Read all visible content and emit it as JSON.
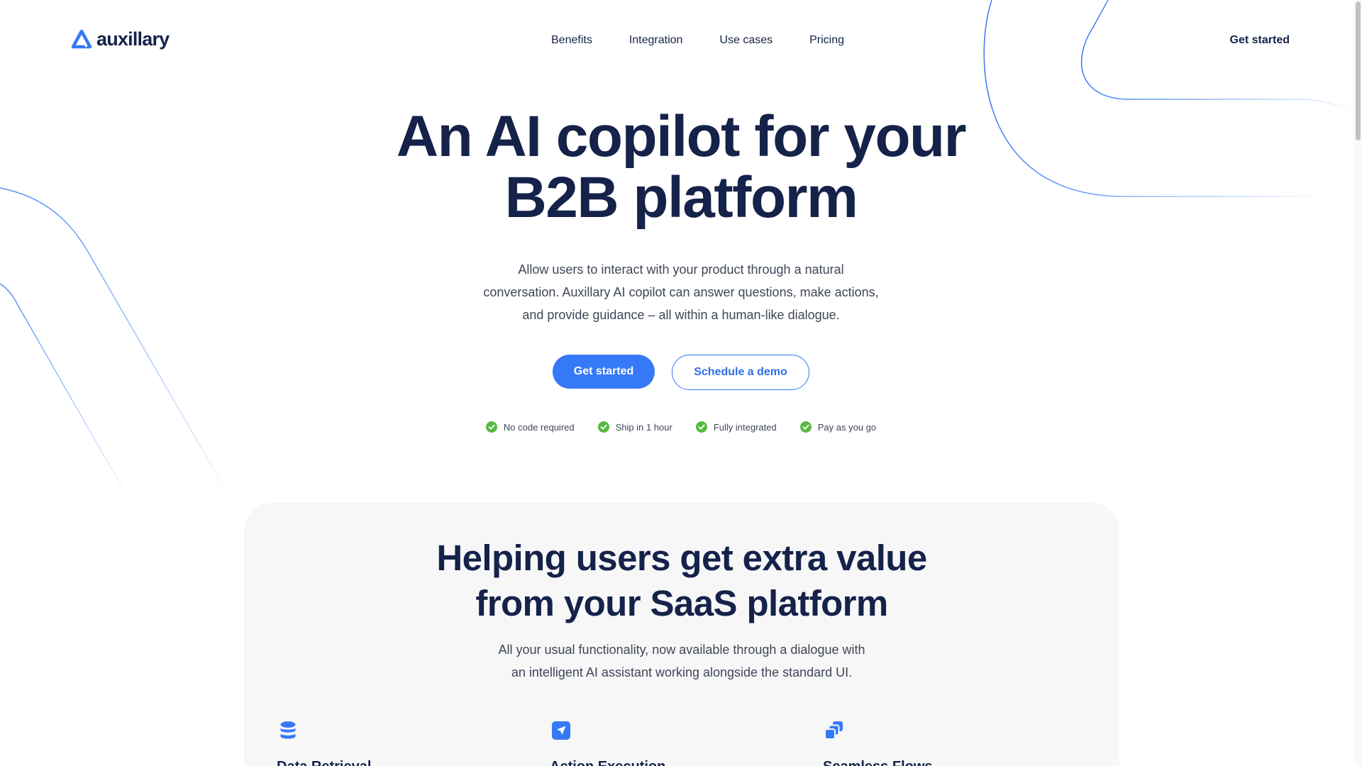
{
  "brand": {
    "name": "auxillary",
    "accent": "#3579f6",
    "ink": "#15224a"
  },
  "nav": {
    "items": [
      "Benefits",
      "Integration",
      "Use cases",
      "Pricing"
    ],
    "cta": "Get started"
  },
  "hero": {
    "title_line1": "An AI copilot for your",
    "title_line2": "B2B platform",
    "description_line1": "Allow users to interact with your product through a natural",
    "description_line2": "conversation. Auxillary AI copilot can answer questions, make actions,",
    "description_line3": "and provide guidance – all within a human-like dialogue.",
    "primary_button": "Get started",
    "secondary_button": "Schedule a demo",
    "features": [
      "No code required",
      "Ship in 1 hour",
      "Fully integrated",
      "Pay as you go"
    ],
    "check_icon": "check-circle-icon",
    "check_color": "#57b93f"
  },
  "value": {
    "title_line1": "Helping users get extra value",
    "title_line2": "from your SaaS platform",
    "description_line1": "All your usual functionality, now available through a dialogue with",
    "description_line2": "an intelligent AI assistant working alongside the standard UI.",
    "cards": [
      {
        "icon": "database-icon",
        "title": "Data Retrieval"
      },
      {
        "icon": "send-icon",
        "title": "Action Execution"
      },
      {
        "icon": "stacked-cards-icon",
        "title": "Seamless Flows"
      }
    ]
  }
}
